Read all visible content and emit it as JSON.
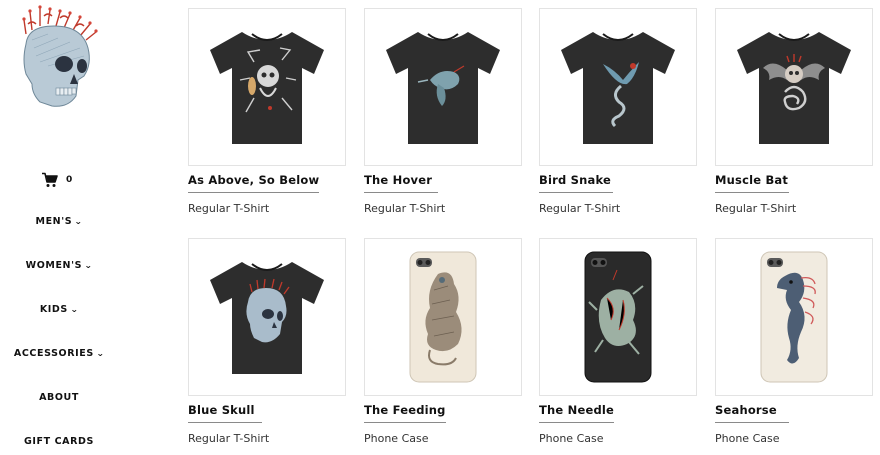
{
  "sidebar": {
    "logo_icon": "skull-with-crown-logo",
    "cart": {
      "icon": "cart-icon",
      "count": "0"
    },
    "nav": [
      {
        "label": "MEN'S",
        "has_dropdown": true
      },
      {
        "label": "WOMEN'S",
        "has_dropdown": true
      },
      {
        "label": "KIDS",
        "has_dropdown": true
      },
      {
        "label": "ACCESSORIES",
        "has_dropdown": true
      },
      {
        "label": "ABOUT",
        "has_dropdown": false
      },
      {
        "label": "GIFT CARDS",
        "has_dropdown": false
      }
    ],
    "chevron_glyph": "⌄"
  },
  "products": [
    {
      "title": "As Above, So Below",
      "type": "Regular T-Shirt",
      "image_icon": "black-tshirt-skull-spider-art"
    },
    {
      "title": "The Hover",
      "type": "Regular T-Shirt",
      "image_icon": "black-tshirt-hummingbird-art"
    },
    {
      "title": "Bird Snake",
      "type": "Regular T-Shirt",
      "image_icon": "black-tshirt-bird-snake-art"
    },
    {
      "title": "Muscle Bat",
      "type": "Regular T-Shirt",
      "image_icon": "black-tshirt-winged-skull-art"
    },
    {
      "title": "Blue Skull",
      "type": "Regular T-Shirt",
      "image_icon": "black-tshirt-blue-skull-art"
    },
    {
      "title": "The Feeding",
      "type": "Phone Case",
      "image_icon": "cream-phone-case-creature-art"
    },
    {
      "title": "The Needle",
      "type": "Phone Case",
      "image_icon": "black-phone-case-creature-art"
    },
    {
      "title": "Seahorse",
      "type": "Phone Case",
      "image_icon": "cream-phone-case-seahorse-art"
    }
  ],
  "colors": {
    "shirt": "#2d2d2d",
    "case_light": "#f0e8da",
    "case_dark": "#2a2a2a",
    "card_border": "#e3e3e3"
  }
}
